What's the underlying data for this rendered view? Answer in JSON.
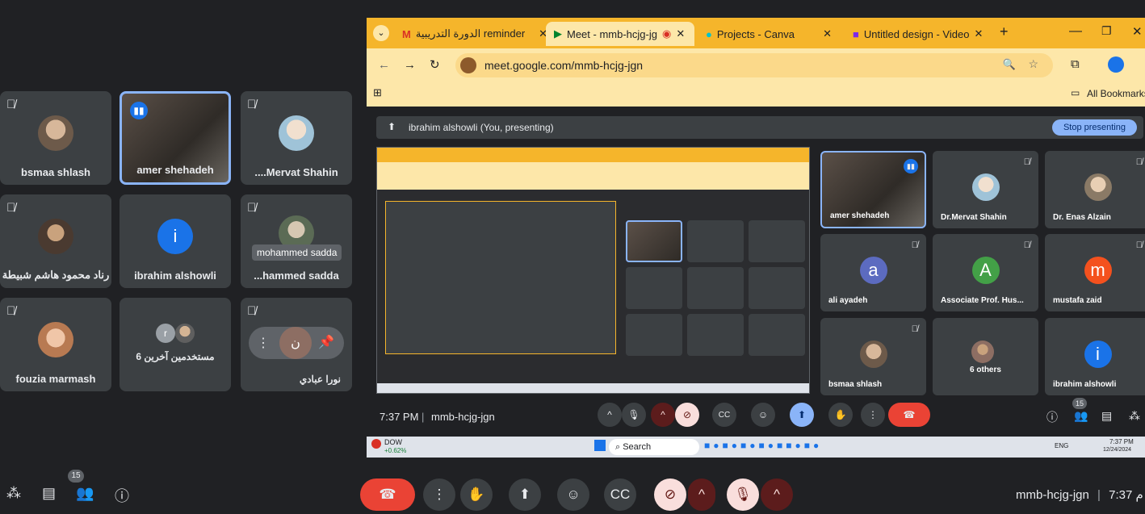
{
  "left_grid": {
    "tiles": [
      {
        "name": "bsmaa shlash",
        "muted": true
      },
      {
        "name": "amer shehadeh",
        "active": true
      },
      {
        "name": "....Mervat Shahin",
        "muted": true
      },
      {
        "name": "رناد محمود هاشم شبيطة",
        "muted": true
      },
      {
        "name": "ibrahim alshowli",
        "letter": "i"
      },
      {
        "name": "...hammed sadda",
        "muted": true,
        "tooltip": "mohammed sadda"
      },
      {
        "name": "fouzia marmash",
        "muted": true
      },
      {
        "name": "6 مستخدمين آخرين",
        "letter": "r"
      },
      {
        "name": "نورا عبادي",
        "muted": true,
        "letter": "ن"
      }
    ]
  },
  "bottom_bar": {
    "left_badge": "15",
    "meeting_code": "mmb-hcjg-jgn",
    "time_label": "7:37 م",
    "separator": "|"
  },
  "browser": {
    "tabs": [
      {
        "label": "الدورة التدريبية reminder",
        "icon": "gmail-icon"
      },
      {
        "label": "Meet - mmb-hcjg-jg",
        "icon": "meet-icon",
        "active": true
      },
      {
        "label": "Projects - Canva",
        "icon": "canva-icon"
      },
      {
        "label": "Untitled design - Video",
        "icon": "canva-video-icon"
      }
    ],
    "url": "meet.google.com/mmb-hcjg-jgn",
    "bookmarks_label": "All Bookmarks",
    "presenting_label": "ibrahim alshowli (You, presenting)",
    "stop_label": "Stop presenting",
    "right_tiles": [
      {
        "name": "amer shehadeh",
        "video": true
      },
      {
        "name": "Dr.Mervat Shahin"
      },
      {
        "name": "Dr. Enas Alzain"
      },
      {
        "name": "ali ayadeh",
        "letter": "a",
        "color": "#5c6bc0"
      },
      {
        "name": "Associate Prof. Hus...",
        "letter": "A",
        "color": "#43a047"
      },
      {
        "name": "mustafa zaid",
        "letter": "m",
        "color": "#f4511e"
      },
      {
        "name": "bsmaa shlash"
      },
      {
        "name": "6 others"
      },
      {
        "name": "ibrahim alshowli",
        "letter": "i",
        "color": "#1a73e8"
      }
    ],
    "inner_bar": {
      "time": "7:37 PM",
      "code": "mmb-hcjg-jgn",
      "badge": "15"
    },
    "taskbar": {
      "stock_label": "DOW",
      "stock_change": "+0.62%",
      "search_label": "Search",
      "lang": "ENG",
      "clock_time": "7:37 PM",
      "clock_date": "12/24/2024"
    }
  },
  "colors": {
    "bg": "#202124",
    "tile": "#3c4043",
    "accent": "#8ab4f8",
    "end_call": "#ea4335",
    "tab_bar": "#f5b52b"
  }
}
